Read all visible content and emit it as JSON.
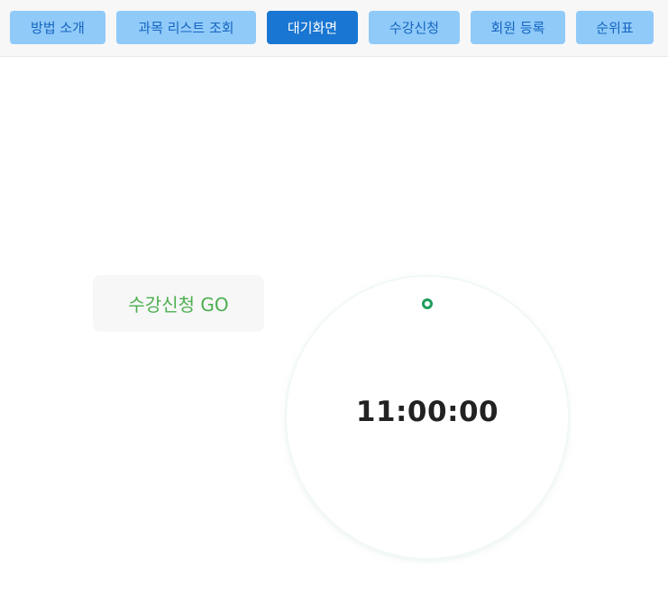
{
  "nav": {
    "items": [
      {
        "label": "방법 소개",
        "active": false
      },
      {
        "label": "과목 리스트 조회",
        "active": false
      },
      {
        "label": "대기화면",
        "active": true
      },
      {
        "label": "수강신청",
        "active": false
      },
      {
        "label": "회원 등록",
        "active": false
      },
      {
        "label": "순위표",
        "active": false
      }
    ]
  },
  "main": {
    "go_button_label": "수강신청 GO",
    "timer": "11:00:00"
  },
  "colors": {
    "nav_bg": "#90caf9",
    "nav_text": "#1565c0",
    "nav_active_bg": "#1976d2",
    "go_text": "#4caf50",
    "dot": "#1f9e5c"
  }
}
